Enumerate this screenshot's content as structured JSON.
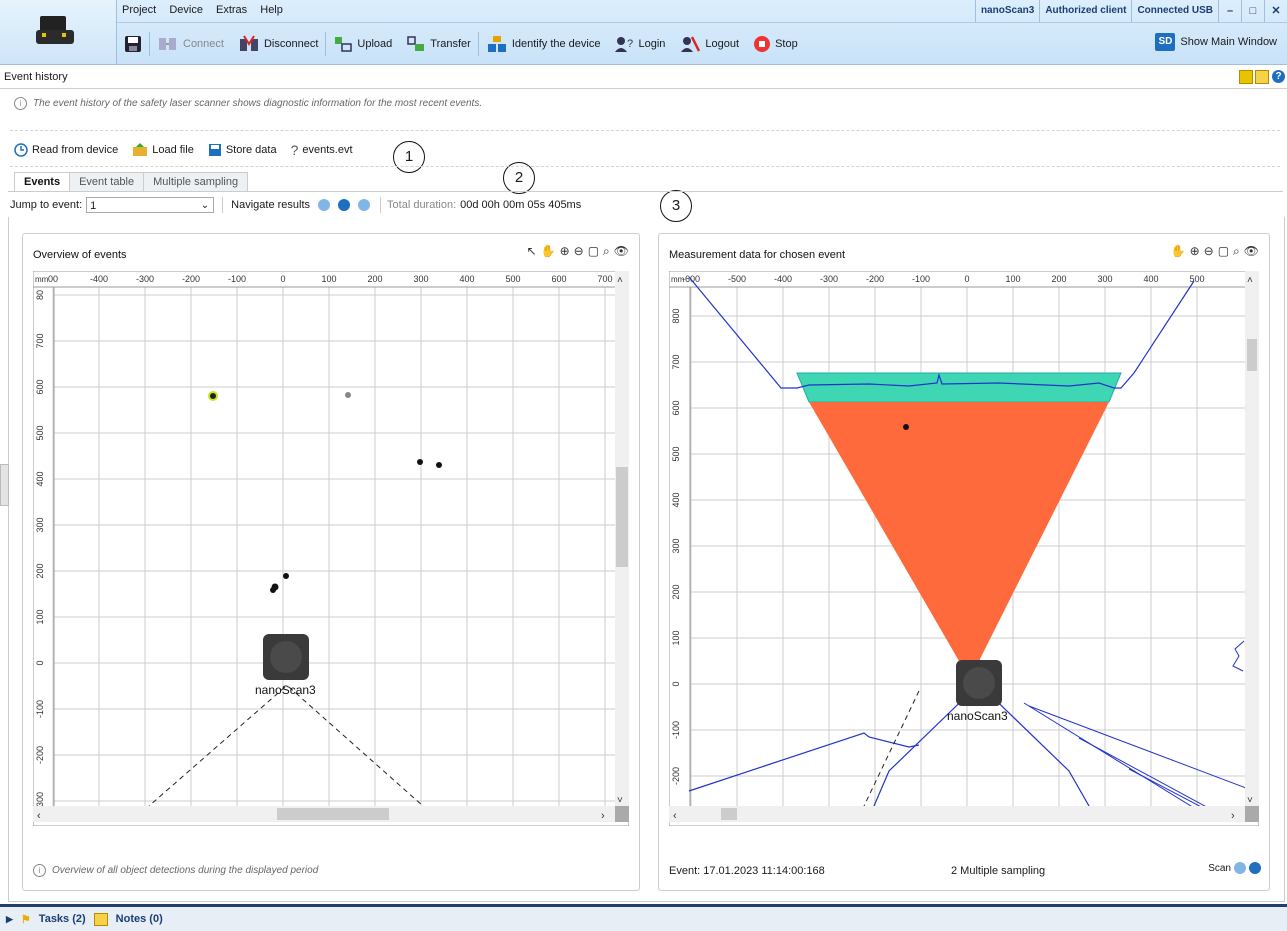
{
  "menu": {
    "items": [
      "Project",
      "Device",
      "Extras",
      "Help"
    ]
  },
  "connection": {
    "device": "nanoScan3",
    "client": "Authorized client",
    "status": "Connected USB"
  },
  "toolbar": {
    "connect": "Connect",
    "disconnect": "Disconnect",
    "upload": "Upload",
    "transfer": "Transfer",
    "identify": "Identify the device",
    "login": "Login",
    "logout": "Logout",
    "stop": "Stop",
    "show_main": "Show Main Window",
    "sd_badge": "SD"
  },
  "page": {
    "title": "Event history",
    "description": "The event history of the safety laser scanner shows diagnostic information for the most recent events."
  },
  "actions": {
    "read": "Read from device",
    "load": "Load file",
    "store": "Store data",
    "file": "events.evt"
  },
  "callouts": [
    "1",
    "2",
    "3"
  ],
  "tabs": [
    "Events",
    "Event table",
    "Multiple sampling"
  ],
  "nav": {
    "jump_label": "Jump to event:",
    "jump_value": "1",
    "navigate_label": "Navigate results",
    "duration_label": "Total duration:",
    "duration_value": "00d 00h 00m 05s 405ms"
  },
  "left_panel": {
    "title": "Overview of events",
    "unit": "mm",
    "x_ticks": [
      "00",
      "-400",
      "-300",
      "-200",
      "-100",
      "0",
      "100",
      "200",
      "300",
      "400",
      "500",
      "600",
      "700"
    ],
    "y_ticks": [
      "80",
      "700",
      "600",
      "500",
      "400",
      "300",
      "200",
      "100",
      "0",
      "-100",
      "-200",
      "-300"
    ],
    "device_label": "nanoScan3",
    "footer": "Overview of all object detections during the displayed period"
  },
  "right_panel": {
    "title": "Measurement data for chosen event",
    "unit": "mm",
    "x_ticks": [
      "-600",
      "-500",
      "-400",
      "-300",
      "-200",
      "-100",
      "0",
      "100",
      "200",
      "300",
      "400",
      "500"
    ],
    "y_ticks": [
      "800",
      "700",
      "600",
      "500",
      "400",
      "300",
      "200",
      "100",
      "0",
      "-100",
      "-200"
    ],
    "device_label": "nanoScan3",
    "event_label": "Event:",
    "event_value": "17.01.2023 11:14:00:168",
    "sampling": "2 Multiple sampling",
    "scan_label": "Scan"
  },
  "footer": {
    "tasks": "Tasks (2)",
    "notes": "Notes (0)"
  },
  "colors": {
    "accent": "#1f6fc0",
    "warning_field": "#ff6a3d",
    "protective_field": "#3fd6b4",
    "contour": "#2233cc"
  }
}
